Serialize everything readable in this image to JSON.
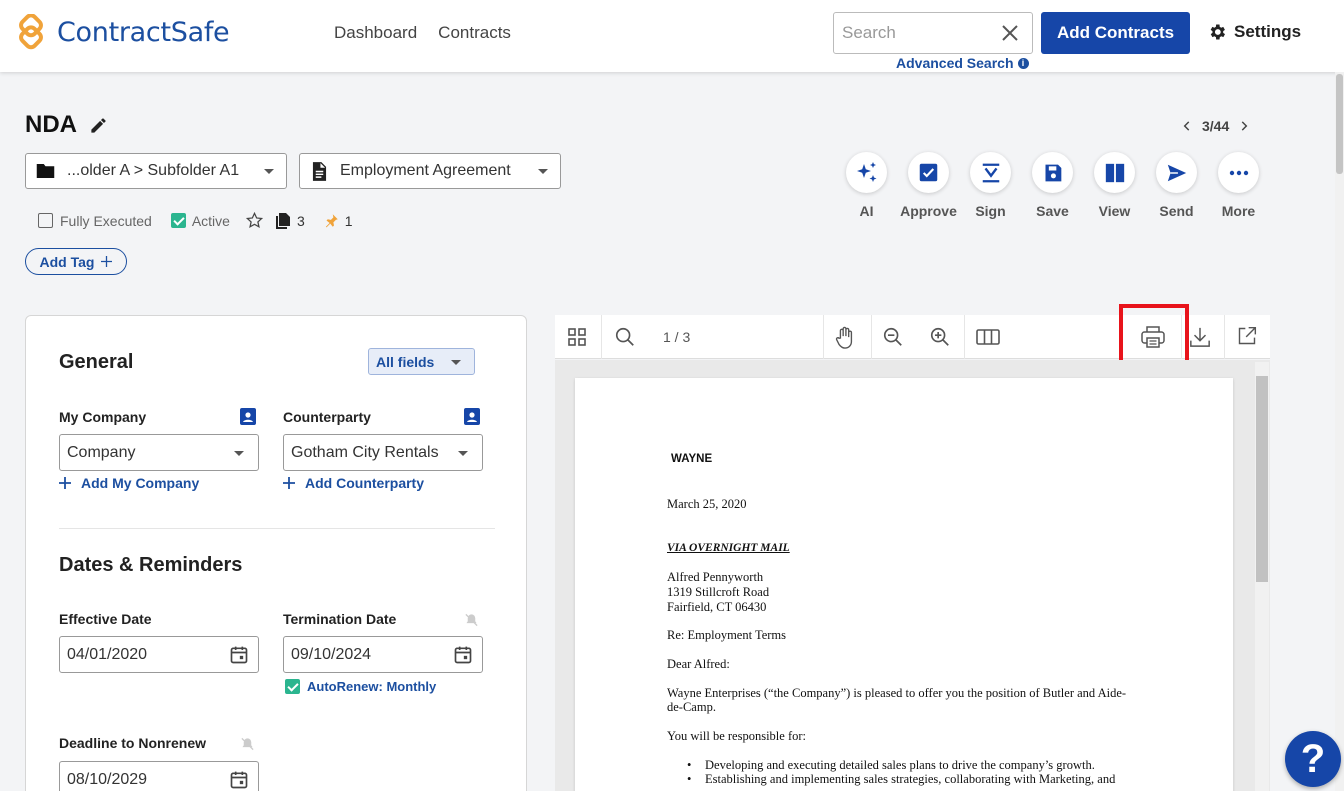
{
  "brand": {
    "name": "ContractSafe"
  },
  "nav": {
    "dashboard": "Dashboard",
    "contracts": "Contracts"
  },
  "search": {
    "placeholder": "Search",
    "advanced": "Advanced Search",
    "info": "i"
  },
  "header": {
    "add_contracts": "Add Contracts",
    "settings": "Settings"
  },
  "contract": {
    "title": "NDA",
    "pager": "3/44",
    "folder": "...older A > Subfolder A1",
    "type": "Employment Agreement",
    "fully_executed": "Fully Executed",
    "active": "Active",
    "doc_count": "3",
    "pin_count": "1",
    "add_tag": "Add Tag"
  },
  "actions": [
    {
      "label": "AI",
      "icon": "ai-sparkle-icon"
    },
    {
      "label": "Approve",
      "icon": "approve-check-icon"
    },
    {
      "label": "Sign",
      "icon": "sign-icon"
    },
    {
      "label": "Save",
      "icon": "save-icon"
    },
    {
      "label": "View",
      "icon": "view-columns-icon"
    },
    {
      "label": "Send",
      "icon": "send-icon"
    },
    {
      "label": "More",
      "icon": "more-dots-icon"
    }
  ],
  "general": {
    "title": "General",
    "all_fields": "All fields",
    "my_company_label": "My Company",
    "my_company_value": "Company",
    "add_my_company": "Add My Company",
    "counterparty_label": "Counterparty",
    "counterparty_value": "Gotham City Rentals",
    "add_counterparty": "Add Counterparty"
  },
  "dates": {
    "title": "Dates & Reminders",
    "effective_label": "Effective Date",
    "effective_value": "04/01/2020",
    "termination_label": "Termination Date",
    "termination_value": "09/10/2024",
    "autorenew": "AutoRenew: Monthly",
    "deadline_label": "Deadline to Nonrenew",
    "deadline_value": "08/10/2029"
  },
  "viewer": {
    "page_indicator": "1 / 3"
  },
  "document": {
    "company": "WAYNE",
    "date": "March 25, 2020",
    "delivery": "VIA OVERNIGHT MAIL",
    "addr1": "Alfred Pennyworth",
    "addr2": "1319 Stillcroft Road",
    "addr3": "Fairfield, CT 06430",
    "re": "Re: Employment Terms",
    "salutation": "Dear Alfred:",
    "para1a": "Wayne Enterprises (“the Company”) is pleased to offer you the position of Butler and Aide-",
    "para1b": "de-Camp.",
    "resp": "You will be responsible for:",
    "bullet1": "Developing and executing detailed sales plans to drive the company’s growth.",
    "bullet2": "Establishing and implementing sales strategies, collaborating with Marketing, and"
  },
  "help": {
    "label": "?"
  },
  "colors": {
    "brand_blue": "#1646a8",
    "link_blue": "#1c4fa0",
    "active_green": "#2bb58f",
    "highlight_red": "#e8131b"
  }
}
